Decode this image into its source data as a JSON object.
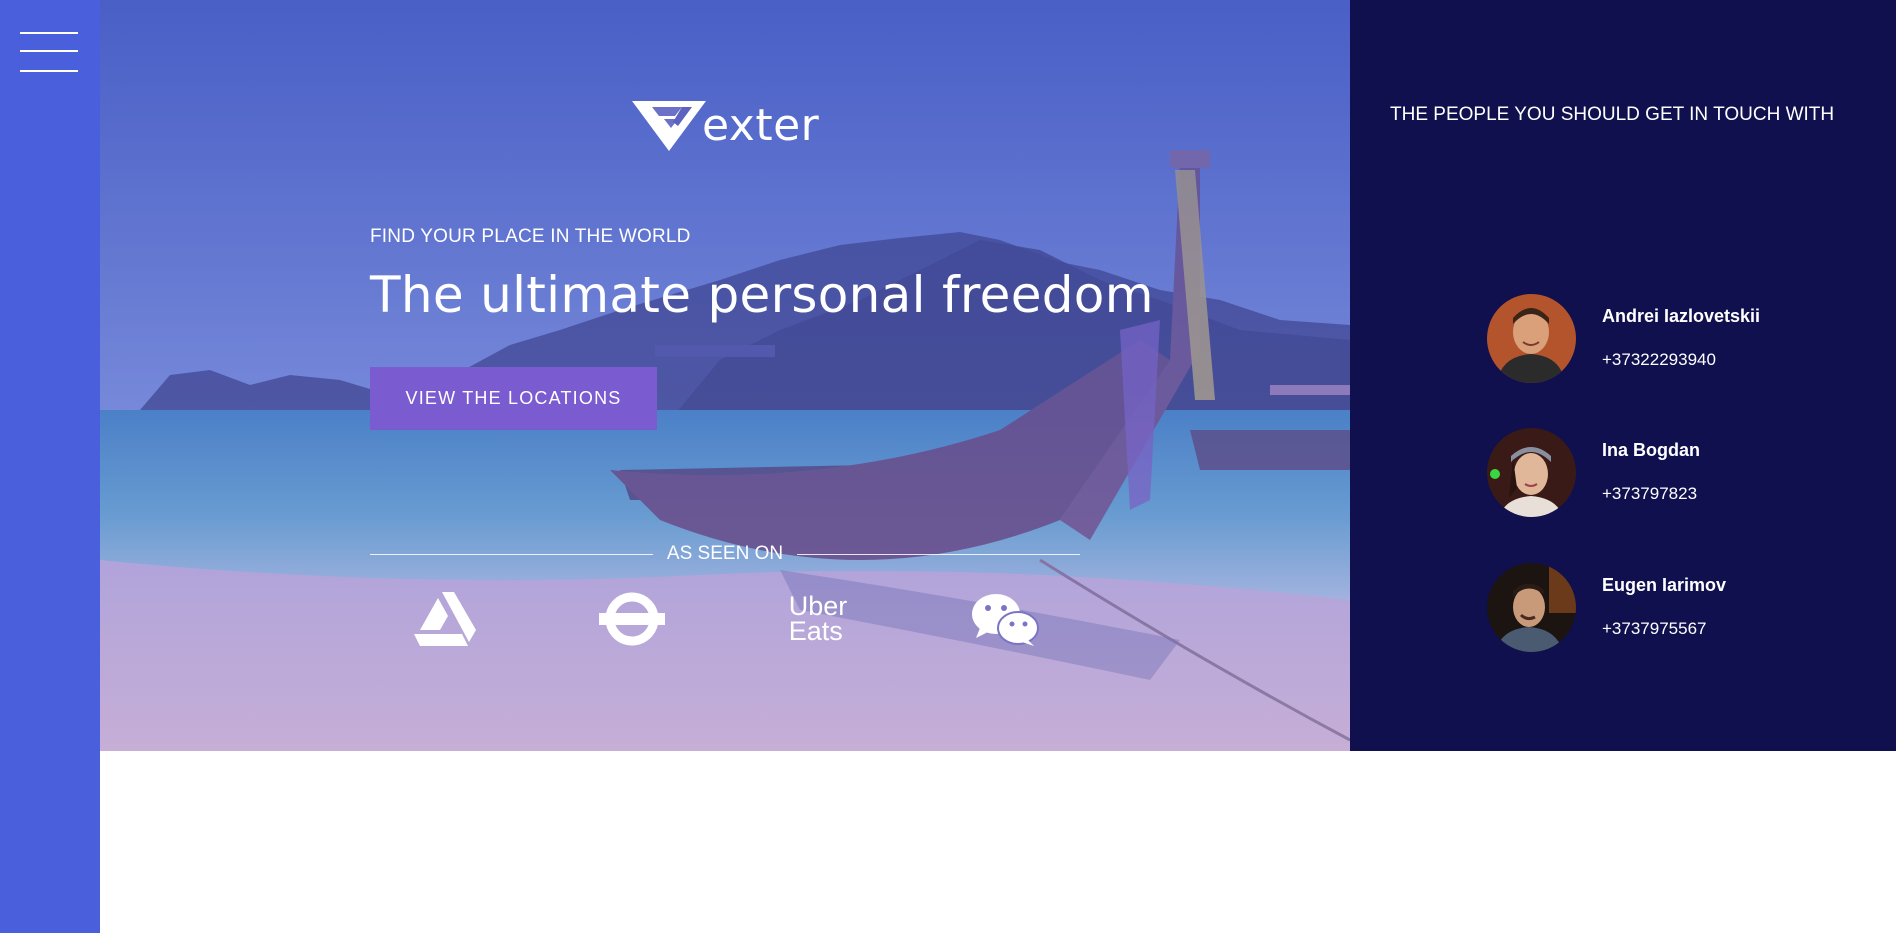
{
  "nav": {
    "menu_icon": "hamburger-menu-icon"
  },
  "brand": {
    "logo_text": "exter",
    "logo_icon": "v-chevron-logo-icon"
  },
  "hero": {
    "tagline": "FIND YOUR PLACE IN THE WORLD",
    "headline": "The ultimate personal freedom",
    "cta_label": "VIEW THE LOCATIONS",
    "background": "tropical-beach-longtail-boat-photo"
  },
  "seen_on": {
    "label": "AS SEEN ON",
    "partners": [
      {
        "icon": "artstation-logo-icon"
      },
      {
        "icon": "london-underground-logo-icon"
      },
      {
        "icon": "uber-eats-logo-icon",
        "line1": "Uber",
        "line2": "Eats"
      },
      {
        "icon": "wechat-logo-icon"
      }
    ]
  },
  "contacts": {
    "title": "THE PEOPLE YOU SHOULD GET IN TOUCH WITH",
    "people": [
      {
        "name": "Andrei Iazlovetskii",
        "phone": "+37322293940"
      },
      {
        "name": "Ina Bogdan",
        "phone": "+373797823"
      },
      {
        "name": "Eugen Iarimov",
        "phone": "+3737975567"
      }
    ]
  },
  "colors": {
    "sidebar": "#4a5fdc",
    "contacts_bg": "#11104e",
    "cta_bg": "#7a5cd0"
  }
}
